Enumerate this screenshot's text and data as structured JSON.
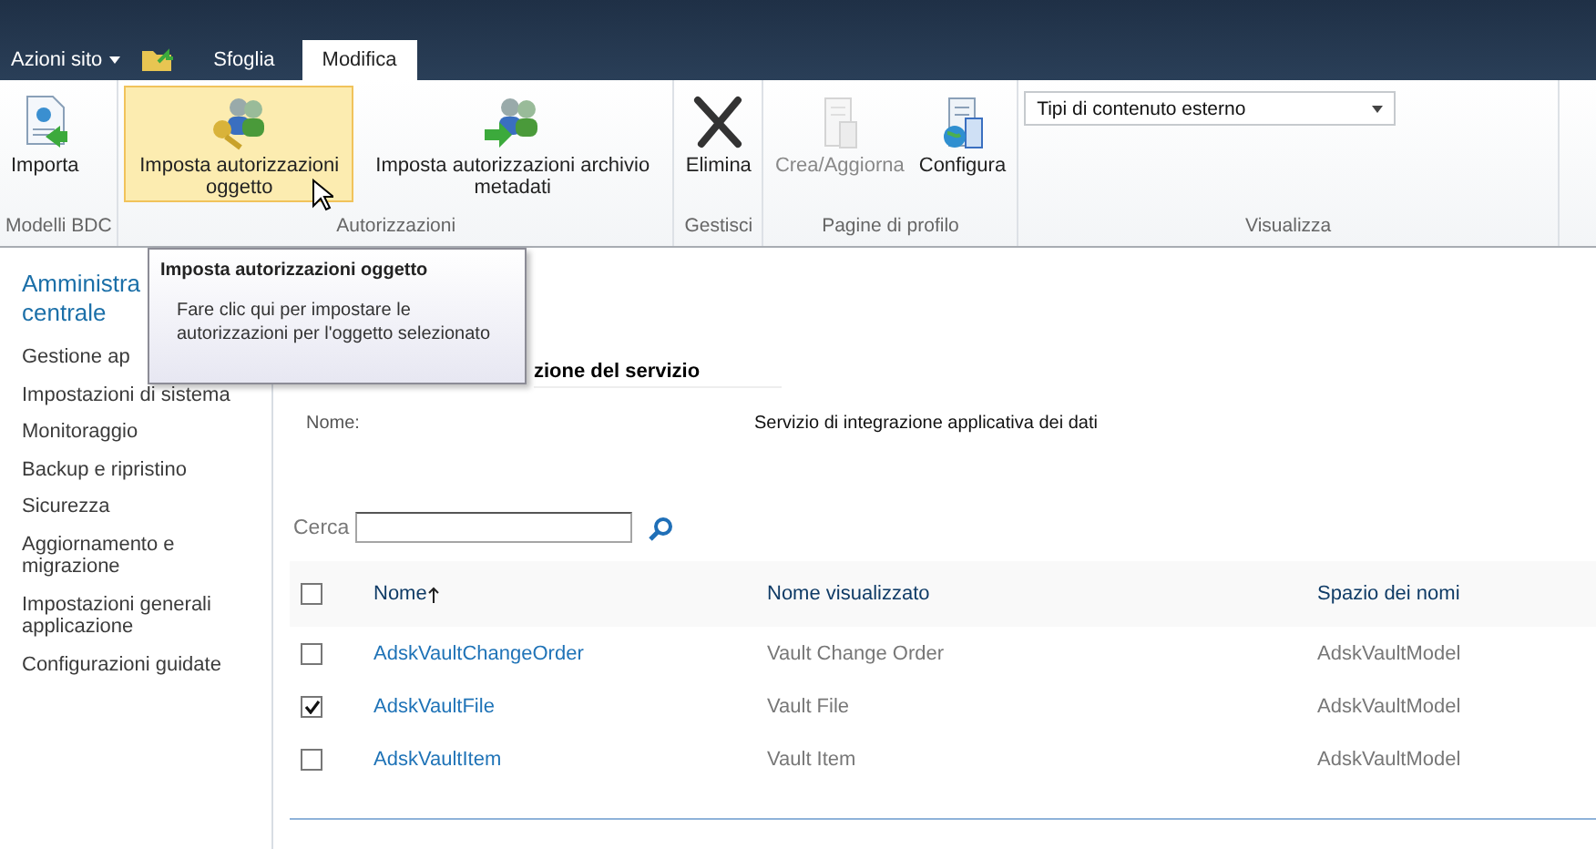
{
  "top_bar": {
    "site_actions": "Azioni sito",
    "tabs": [
      {
        "label": "Sfoglia",
        "selected": false
      },
      {
        "label": "Modifica",
        "selected": true
      }
    ]
  },
  "ribbon": {
    "groups": [
      {
        "label": "Modelli BDC",
        "buttons": [
          {
            "label": "Importa",
            "hover": false,
            "disabled": false
          }
        ]
      },
      {
        "label": "Autorizzazioni",
        "buttons": [
          {
            "label": "Imposta autorizzazioni oggetto",
            "hover": true,
            "disabled": false
          },
          {
            "label": "Imposta autorizzazioni archivio metadati",
            "hover": false,
            "disabled": false
          }
        ]
      },
      {
        "label": "Gestisci",
        "buttons": [
          {
            "label": "Elimina",
            "hover": false,
            "disabled": false
          }
        ]
      },
      {
        "label": "Pagine di profilo",
        "buttons": [
          {
            "label": "Crea/Aggiorna",
            "hover": false,
            "disabled": true
          },
          {
            "label": "Configura",
            "hover": false,
            "disabled": false
          }
        ]
      },
      {
        "label": "Visualizza",
        "dropdown": {
          "value": "Tipi di contenuto esterno"
        }
      }
    ]
  },
  "tooltip": {
    "title": "Imposta autorizzazioni oggetto",
    "text": "Fare clic qui per impostare le autorizzazioni per l'oggetto selezionato"
  },
  "sidebar": {
    "heading": "Amministra",
    "heading_line2": "centrale",
    "items": [
      "Gestione ap",
      "Impostazioni di sistema",
      "Monitoraggio",
      "Backup e ripristino",
      "Sicurezza",
      "Aggiornamento e migrazione",
      "Impostazioni generali applicazione",
      "Configurazioni guidate"
    ]
  },
  "section": {
    "title": "zione del servizio",
    "name_label": "Nome:",
    "name_value": "Servizio di integrazione applicativa dei dati"
  },
  "search": {
    "label": "Cerca"
  },
  "table": {
    "all_checked": false,
    "columns": [
      {
        "label": "Nome",
        "sorted": true
      },
      {
        "label": "Nome visualizzato",
        "sorted": false
      },
      {
        "label": "Spazio dei nomi",
        "sorted": false
      }
    ],
    "rows": [
      {
        "checked": false,
        "name": "AdskVaultChangeOrder",
        "display": "Vault Change Order",
        "namespace": "AdskVaultModel"
      },
      {
        "checked": true,
        "name": "AdskVaultFile",
        "display": "Vault File",
        "namespace": "AdskVaultModel"
      },
      {
        "checked": false,
        "name": "AdskVaultItem",
        "display": "Vault Item",
        "namespace": "AdskVaultModel"
      }
    ]
  }
}
